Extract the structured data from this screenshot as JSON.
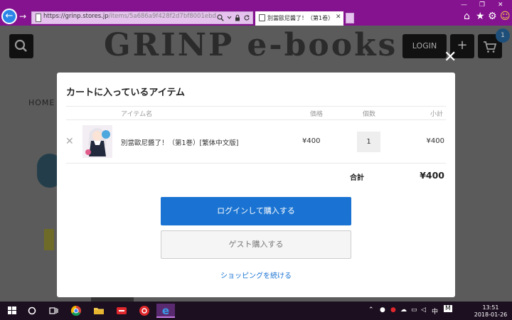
{
  "browser": {
    "url_prefix": "https://grinp.stores.jp",
    "url_path": "/items/5a686a9f428f2d7bf8001ebd",
    "tab_title": "別當歐尼醬了！（第1卷）[..."
  },
  "site": {
    "logo": "GRINP e-books",
    "login_label": "LOGIN",
    "cart_badge": "1",
    "home_label": "HOME"
  },
  "cart_modal": {
    "title": "カートに入っているアイテム",
    "columns": {
      "item": "アイテム名",
      "price": "価格",
      "qty": "個数",
      "subtotal": "小計"
    },
    "items": [
      {
        "name": "別當歐尼醬了！（第1巻）[繁体中文版]",
        "price": "¥400",
        "qty": "1",
        "subtotal": "¥400"
      }
    ],
    "total_label": "合計",
    "total_value": "¥400",
    "login_purchase_label": "ログインして購入する",
    "guest_purchase_label": "ゲスト購入する",
    "continue_label": "ショッピングを続ける"
  },
  "taskbar": {
    "ime_label": "中",
    "clock_time": "13:51",
    "clock_date": "2018-01-26"
  },
  "colors": {
    "browser_chrome": "#85128f",
    "primary_button": "#1a73d2",
    "taskbar": "#1c0f20"
  }
}
